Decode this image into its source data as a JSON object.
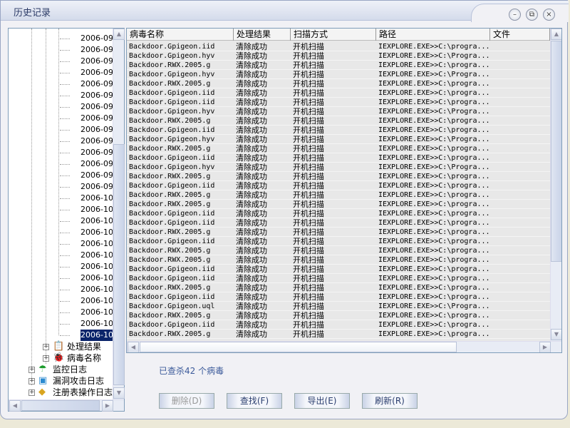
{
  "window": {
    "title": "历史记录",
    "minimize": "–",
    "restore": "⧉",
    "close": "×"
  },
  "tree": {
    "dates": [
      "2006-09",
      "2006-09",
      "2006-09",
      "2006-09",
      "2006-09",
      "2006-09",
      "2006-09",
      "2006-09",
      "2006-09",
      "2006-09",
      "2006-09",
      "2006-09",
      "2006-09",
      "2006-09",
      "2006-10",
      "2006-10",
      "2006-10",
      "2006-10",
      "2006-10",
      "2006-10",
      "2006-10",
      "2006-10",
      "2006-10",
      "2006-10",
      "2006-10",
      "2006-10",
      "2006-10"
    ],
    "selected_index": 26,
    "nodes": [
      {
        "label": "处理结果",
        "icon": "report-icon"
      },
      {
        "label": "病毒名称",
        "icon": "virus-file-icon"
      },
      {
        "label": "监控日志",
        "icon": "umbrella-icon"
      },
      {
        "label": "漏洞攻击日志",
        "icon": "exploit-icon"
      },
      {
        "label": "注册表操作日志",
        "icon": "registry-icon"
      }
    ]
  },
  "list": {
    "columns": [
      "病毒名称",
      "处理结果",
      "扫描方式",
      "路径",
      "文件"
    ],
    "rows": [
      [
        "Backdoor.Gpigeon.iid",
        "清除成功",
        "开机扫描",
        "IEXPLORE.EXE>>C:\\progra..."
      ],
      [
        "Backdoor.Gpigeon.hyv",
        "清除成功",
        "开机扫描",
        "IEXPLORE.EXE>>C:\\Progra..."
      ],
      [
        "Backdoor.RWX.2005.g",
        "清除成功",
        "开机扫描",
        "IEXPLORE.EXE>>C:\\progra..."
      ],
      [
        "Backdoor.Gpigeon.hyv",
        "清除成功",
        "开机扫描",
        "IEXPLORE.EXE>>C:\\Progra..."
      ],
      [
        "Backdoor.RWX.2005.g",
        "清除成功",
        "开机扫描",
        "IEXPLORE.EXE>>C:\\progra..."
      ],
      [
        "Backdoor.Gpigeon.iid",
        "清除成功",
        "开机扫描",
        "IEXPLORE.EXE>>C:\\progra..."
      ],
      [
        "Backdoor.Gpigeon.iid",
        "清除成功",
        "开机扫描",
        "IEXPLORE.EXE>>C:\\progra..."
      ],
      [
        "Backdoor.Gpigeon.hyv",
        "清除成功",
        "开机扫描",
        "IEXPLORE.EXE>>C:\\Progra..."
      ],
      [
        "Backdoor.RWX.2005.g",
        "清除成功",
        "开机扫描",
        "IEXPLORE.EXE>>C:\\progra..."
      ],
      [
        "Backdoor.Gpigeon.iid",
        "清除成功",
        "开机扫描",
        "IEXPLORE.EXE>>C:\\progra..."
      ],
      [
        "Backdoor.Gpigeon.hyv",
        "清除成功",
        "开机扫描",
        "IEXPLORE.EXE>>C:\\Progra..."
      ],
      [
        "Backdoor.RWX.2005.g",
        "清除成功",
        "开机扫描",
        "IEXPLORE.EXE>>C:\\progra..."
      ],
      [
        "Backdoor.Gpigeon.iid",
        "清除成功",
        "开机扫描",
        "IEXPLORE.EXE>>C:\\progra..."
      ],
      [
        "Backdoor.Gpigeon.hyv",
        "清除成功",
        "开机扫描",
        "IEXPLORE.EXE>>C:\\Progra..."
      ],
      [
        "Backdoor.RWX.2005.g",
        "清除成功",
        "开机扫描",
        "IEXPLORE.EXE>>C:\\progra..."
      ],
      [
        "Backdoor.Gpigeon.iid",
        "清除成功",
        "开机扫描",
        "IEXPLORE.EXE>>C:\\progra..."
      ],
      [
        "Backdoor.RWX.2005.g",
        "清除成功",
        "开机扫描",
        "IEXPLORE.EXE>>C:\\progra..."
      ],
      [
        "Backdoor.RWX.2005.g",
        "清除成功",
        "开机扫描",
        "IEXPLORE.EXE>>C:\\progra..."
      ],
      [
        "Backdoor.Gpigeon.iid",
        "清除成功",
        "开机扫描",
        "IEXPLORE.EXE>>C:\\progra..."
      ],
      [
        "Backdoor.Gpigeon.iid",
        "清除成功",
        "开机扫描",
        "IEXPLORE.EXE>>C:\\progra..."
      ],
      [
        "Backdoor.RWX.2005.g",
        "清除成功",
        "开机扫描",
        "IEXPLORE.EXE>>C:\\progra..."
      ],
      [
        "Backdoor.Gpigeon.iid",
        "清除成功",
        "开机扫描",
        "IEXPLORE.EXE>>C:\\progra..."
      ],
      [
        "Backdoor.RWX.2005.g",
        "清除成功",
        "开机扫描",
        "IEXPLORE.EXE>>C:\\progra..."
      ],
      [
        "Backdoor.RWX.2005.g",
        "清除成功",
        "开机扫描",
        "IEXPLORE.EXE>>C:\\progra..."
      ],
      [
        "Backdoor.Gpigeon.iid",
        "清除成功",
        "开机扫描",
        "IEXPLORE.EXE>>C:\\progra..."
      ],
      [
        "Backdoor.Gpigeon.iid",
        "清除成功",
        "开机扫描",
        "IEXPLORE.EXE>>C:\\progra..."
      ],
      [
        "Backdoor.RWX.2005.g",
        "清除成功",
        "开机扫描",
        "IEXPLORE.EXE>>C:\\progra..."
      ],
      [
        "Backdoor.Gpigeon.iid",
        "清除成功",
        "开机扫描",
        "IEXPLORE.EXE>>C:\\progra..."
      ],
      [
        "Backdoor.Gpigeon.uql",
        "清除成功",
        "开机扫描",
        "IEXPLORE.EXE>>C:\\Progra..."
      ],
      [
        "Backdoor.RWX.2005.g",
        "清除成功",
        "开机扫描",
        "IEXPLORE.EXE>>C:\\progra..."
      ],
      [
        "Backdoor.Gpigeon.iid",
        "清除成功",
        "开机扫描",
        "IEXPLORE.EXE>>C:\\progra..."
      ],
      [
        "Backdoor.RWX.2005.g",
        "清除成功",
        "开机扫描",
        "IEXPLORE.EXE>>C:\\progra..."
      ]
    ]
  },
  "status": "已查杀42 个病毒",
  "buttons": {
    "delete": "删除(D)",
    "find": "查找(F)",
    "export": "导出(E)",
    "refresh": "刷新(R)"
  }
}
